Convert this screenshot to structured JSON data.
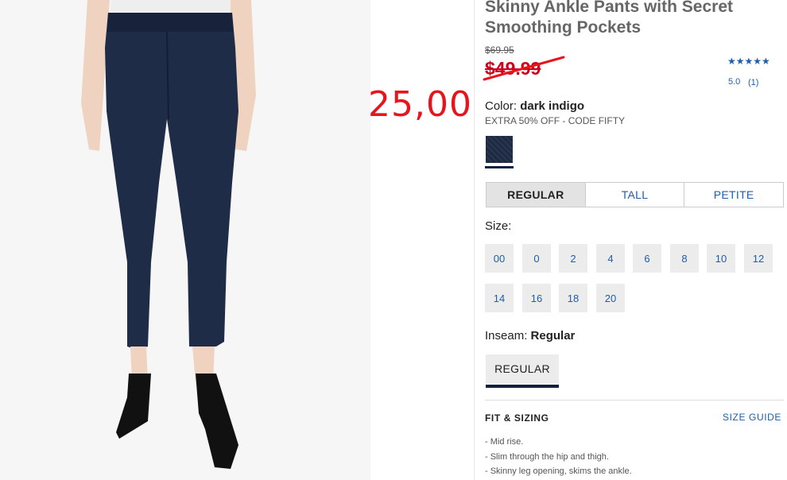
{
  "product": {
    "title": "Skinny Ankle Pants with Secret Smoothing Pockets",
    "original_price": "$69.95",
    "sale_price": "$49.99",
    "annotation_price": "25,00",
    "rating_stars": "★★★★★",
    "rating_value": "5.0",
    "review_count": "(1)"
  },
  "color": {
    "label": "Color:",
    "value": "dark indigo",
    "promo": "EXTRA 50% OFF - CODE FIFTY",
    "swatch_color": "#1c2a43"
  },
  "fit_tabs": [
    {
      "label": "REGULAR",
      "active": true
    },
    {
      "label": "TALL",
      "active": false
    },
    {
      "label": "PETITE",
      "active": false
    }
  ],
  "size": {
    "label": "Size:",
    "options": [
      "00",
      "0",
      "2",
      "4",
      "6",
      "8",
      "10",
      "12",
      "14",
      "16",
      "18",
      "20"
    ]
  },
  "inseam": {
    "label": "Inseam:",
    "value": "Regular",
    "option": "REGULAR"
  },
  "fit_sizing": {
    "heading": "FIT & SIZING",
    "size_guide": "SIZE GUIDE",
    "bullets": [
      "- Mid rise.",
      "- Slim through the hip and thigh.",
      "- Skinny leg opening, skims the ankle."
    ]
  },
  "colors": {
    "link": "#1f5ea8",
    "sale": "#d0021b",
    "annotation": "#e8141c",
    "navy": "#12213d"
  }
}
